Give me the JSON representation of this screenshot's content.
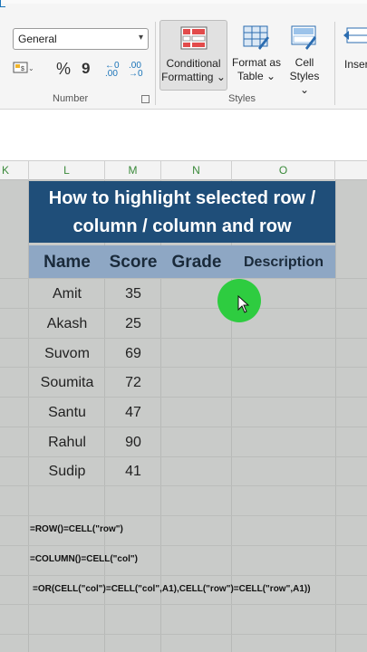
{
  "ribbon": {
    "number_format": "General",
    "number_group_label": "Number",
    "styles_group_label": "Styles",
    "conditional_formatting_line1": "Conditional",
    "conditional_formatting_line2": "Formatting",
    "format_as_table_line1": "Format as",
    "format_as_table_line2": "Table",
    "cell_styles_line1": "Cell",
    "cell_styles_line2": "Styles",
    "insert_label": "Inser",
    "percent_symbol": "%",
    "comma_symbol": "9",
    "increase_decimal": "←0 .00",
    "decrease_decimal": ".00 →0",
    "dropdown_arrow": "⌄"
  },
  "columns": [
    "K",
    "L",
    "M",
    "N",
    "O"
  ],
  "sheet": {
    "title_line1": "How to highlight selected row /",
    "title_line2": "column / column and row",
    "headers": [
      "Name",
      "Score",
      "Grade",
      "Description"
    ],
    "rows": [
      {
        "name": "Amit",
        "score": "35"
      },
      {
        "name": "Akash",
        "score": "25"
      },
      {
        "name": "Suvom",
        "score": "69"
      },
      {
        "name": "Soumita",
        "score": "72"
      },
      {
        "name": "Santu",
        "score": "47"
      },
      {
        "name": "Rahul",
        "score": "90"
      },
      {
        "name": "Sudip",
        "score": "41"
      }
    ],
    "formula_row": "=ROW()=CELL(\"row\")",
    "formula_col": "=COLUMN()=CELL(\"col\")",
    "formula_or": "=OR(CELL(\"col\")=CELL(\"col\",A1),CELL(\"row\")=CELL(\"row\",A1))"
  },
  "colors": {
    "title_bg": "#1f4e79",
    "header_bg": "#8ea7c4",
    "grid_bg": "#c9cbc9",
    "cursor_highlight": "#2ecc40"
  }
}
